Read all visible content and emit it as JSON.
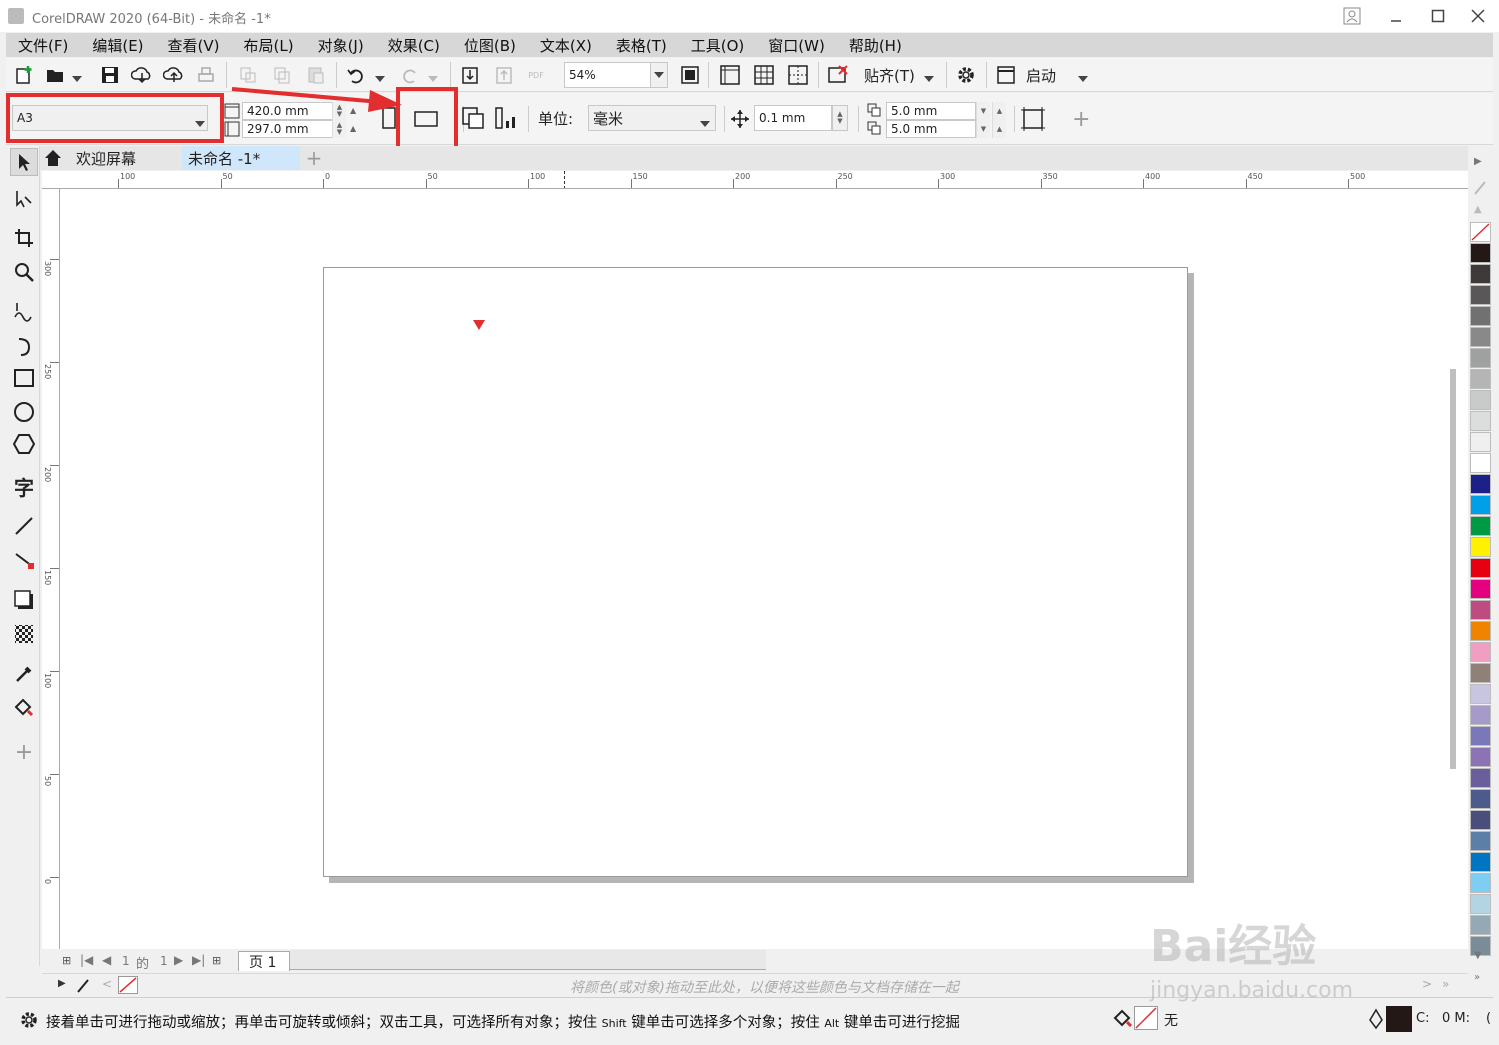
{
  "window": {
    "title": "CorelDRAW 2020 (64-Bit) - 未命名 -1*"
  },
  "menu": [
    "文件(F)",
    "编辑(E)",
    "查看(V)",
    "布局(L)",
    "对象(J)",
    "效果(C)",
    "位图(B)",
    "文本(X)",
    "表格(T)",
    "工具(O)",
    "窗口(W)",
    "帮助(H)"
  ],
  "toolbar": {
    "zoom": "54%",
    "snap_label": "贴齐(T)",
    "launch_label": "启动"
  },
  "property_bar": {
    "page_size": "A3",
    "width": "420.0 mm",
    "height": "297.0 mm",
    "units_label": "单位:",
    "units_value": "毫米",
    "nudge": "0.1 mm",
    "dup_x": "5.0 mm",
    "dup_y": "5.0 mm"
  },
  "tabs": [
    {
      "label": "欢迎屏幕"
    },
    {
      "label": "未命名 -1*"
    }
  ],
  "hruler_labels": [
    "100",
    "50",
    "0",
    "50",
    "100",
    "150",
    "200",
    "250",
    "300",
    "350",
    "400",
    "450",
    "500"
  ],
  "vruler_labels": [
    "300",
    "250",
    "200",
    "150",
    "100",
    "50",
    "0"
  ],
  "page_nav": {
    "current": "1",
    "of": "的",
    "total": "1",
    "page_tab": "页 1"
  },
  "doc_palette_hint": "将颜色(或对象)拖动至此处，以便将这些颜色与文档存储在一起",
  "status": {
    "hint_parts": [
      "接着单击可进行拖动或缩放；再单击可旋转或倾斜；双击工具，可选择所有对象；按住 ",
      "Shift",
      " 键单击可选择多个对象；按住 ",
      "Alt",
      " 键单击可进行挖掘"
    ],
    "fill_label": "无",
    "outline_c": "C:",
    "outline_m": "0 M:",
    "outline_tail": "("
  },
  "watermark": {
    "brand": "Bai经验",
    "url": "jingyan.baidu.com"
  },
  "palette_colors": [
    "#231815",
    "#3e3a39",
    "#595757",
    "#727171",
    "#898989",
    "#9fa0a0",
    "#b5b5b6",
    "#c9caca",
    "#dcdddd",
    "#efefef",
    "#ffffff",
    "#1d2088",
    "#00a0e9",
    "#009944",
    "#fff100",
    "#e60012",
    "#e4007f",
    "#be4c83",
    "#f08300",
    "#f19ec2",
    "#8f8178",
    "#c7c5e0",
    "#a59aca",
    "#7a78b8",
    "#8c73b5",
    "#6b5e9c",
    "#4c5a8c",
    "#4a4e7a",
    "#5c7fa8",
    "#0075c2",
    "#7ecef4",
    "#b2d4e3",
    "#94a8b6",
    "#7a8c98"
  ]
}
